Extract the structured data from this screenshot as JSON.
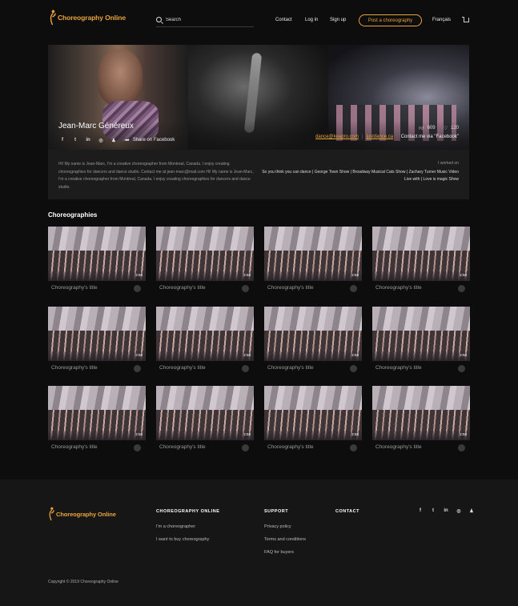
{
  "header": {
    "logo_text": "Choreography Online",
    "search_placeholder": "Search",
    "nav": [
      "Contact",
      "Log in",
      "Sign up"
    ],
    "post_button": "Post a choreography",
    "language": "Français"
  },
  "profile": {
    "name": "Jean-Marc Généreux",
    "share_label": "Share on Facebook",
    "likes": "609",
    "hearts": "120",
    "email": "dance@keapro.com",
    "website": "justdance.ca",
    "contact_fb": "Contact me via \"Facebook\"",
    "bio": "Hi! My name is Jean-Marc, I'm a creative choreographer from Montreal, Canada. I enjoy creating choreographies for dancers and dance studio. Contact me at jean-marc@mail.com Hi! My name is Jean-Marc, I'm a creative choreographer from Montreal, Canada. I enjoy creating choreographies for dancers and dance studio.",
    "worked_label": "I worked on",
    "worked_list": "So you think you can dance | George Town Show | Broadway Musical Cats Show | Zachary Turner Music Video Live with | Love is magic Show"
  },
  "choreographies": {
    "title": "Choreographies",
    "items": [
      {
        "title": "Choreography's title",
        "duration": "2:55"
      },
      {
        "title": "Choreography's title",
        "duration": "2:55"
      },
      {
        "title": "Choreography's title",
        "duration": "2:55"
      },
      {
        "title": "Choreography's title",
        "duration": "2:55"
      },
      {
        "title": "Choreography's title",
        "duration": "2:55"
      },
      {
        "title": "Choreography's title",
        "duration": "2:55"
      },
      {
        "title": "Choreography's title",
        "duration": "2:55"
      },
      {
        "title": "Choreography's title",
        "duration": "2:55"
      },
      {
        "title": "Choreography's title",
        "duration": "2:55"
      },
      {
        "title": "Choreography's title",
        "duration": "2:55"
      },
      {
        "title": "Choreography's title",
        "duration": "2:55"
      },
      {
        "title": "Choreography's title",
        "duration": "2:55"
      }
    ]
  },
  "footer": {
    "logo_text": "Choreography Online",
    "col1_title": "CHOREOGRAPHY ONLINE",
    "col1_links": [
      "I'm a choreographer",
      "I want to buy choreography"
    ],
    "col2_title": "SUPPORT",
    "col2_links": [
      "Privacy policy",
      "Terms and conditions",
      "FAQ for buyers"
    ],
    "col3_title": "CONTACT",
    "copyright": "Copyright © 2019 Choreography Online"
  },
  "colors": {
    "accent": "#e8a33d",
    "background": "#0d0d0d",
    "footer": "#161616"
  },
  "icons": [
    "facebook-icon",
    "twitter-icon",
    "linkedin-icon",
    "instagram-icon",
    "snapchat-icon",
    "share-icon",
    "like-icon",
    "heart-icon",
    "search-icon",
    "cart-icon"
  ]
}
